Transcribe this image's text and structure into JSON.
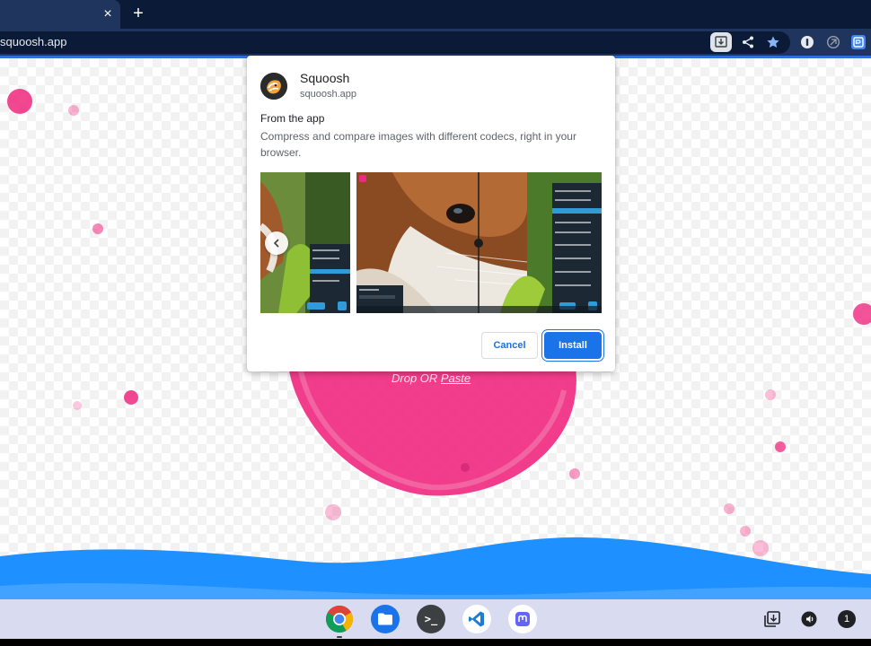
{
  "browser": {
    "tab_close_glyph": "×",
    "new_tab_glyph": "+",
    "url": "squoosh.app",
    "toolbar_icons": [
      "install-app-icon",
      "share-icon",
      "bookmark-star-icon",
      "1password-icon",
      "extension-icon",
      "profile-icon"
    ]
  },
  "page": {
    "drop_label": "Drop OR ",
    "paste_label": "Paste",
    "accent_color": "#f0287f",
    "wave_color": "#1e90ff"
  },
  "dialog": {
    "app_name": "Squoosh",
    "app_url": "squoosh.app",
    "section_title": "From the app",
    "description": "Compress and compare images with different codecs, right in your browser.",
    "screenshots": [
      "red-panda-mobile-screenshot",
      "red-panda-compare-screenshot"
    ],
    "cancel_label": "Cancel",
    "install_label": "Install"
  },
  "shelf": {
    "apps": [
      "chrome-icon",
      "files-icon",
      "terminal-icon",
      "vscode-icon",
      "mastodon-icon"
    ],
    "terminal_glyph": ">_",
    "notification_count": "1",
    "shelf_color": "#d9dcf0"
  }
}
